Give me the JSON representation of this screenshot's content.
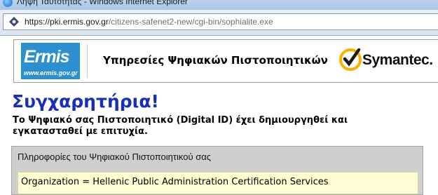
{
  "window": {
    "title": "Λήψη Ταυτότητας - Windows Internet Explorer"
  },
  "address_bar": {
    "scheme": "https://",
    "host": "pki.ermis.gov.gr",
    "path": "/citizens-safenet2-new/cgi-bin/sophialite.exe"
  },
  "header": {
    "logo_text": "Ermis",
    "logo_url": "www.ermis.gov.gr",
    "title": "Υπηρεσίες Ψηφιακών Πιστοποιητικών",
    "brand": "Symantec."
  },
  "content": {
    "headline": "Συγχαρητήρια!",
    "message_line1": "Το Ψηφιακό σας Πιστοποιητικό (Digital ID) έχει δημιουργηθεί και",
    "message_line2": "εγκατασταθεί με επιτυχία."
  },
  "info_panel": {
    "title": "Πληροφορίες του Ψηφιακού Πιστοποιητικού σας",
    "row": "Organization = Hellenic Public Administration Certification Services"
  },
  "colors": {
    "headline": "#1a2fb8",
    "logo_bg": "#2b8fd0",
    "symantec_check": "#f6b400",
    "panel_bg": "#cfcfcf",
    "row_bg": "#fdfcd2"
  },
  "icons": [
    "ie-icon",
    "site-lock-icon",
    "symantec-check-icon"
  ]
}
